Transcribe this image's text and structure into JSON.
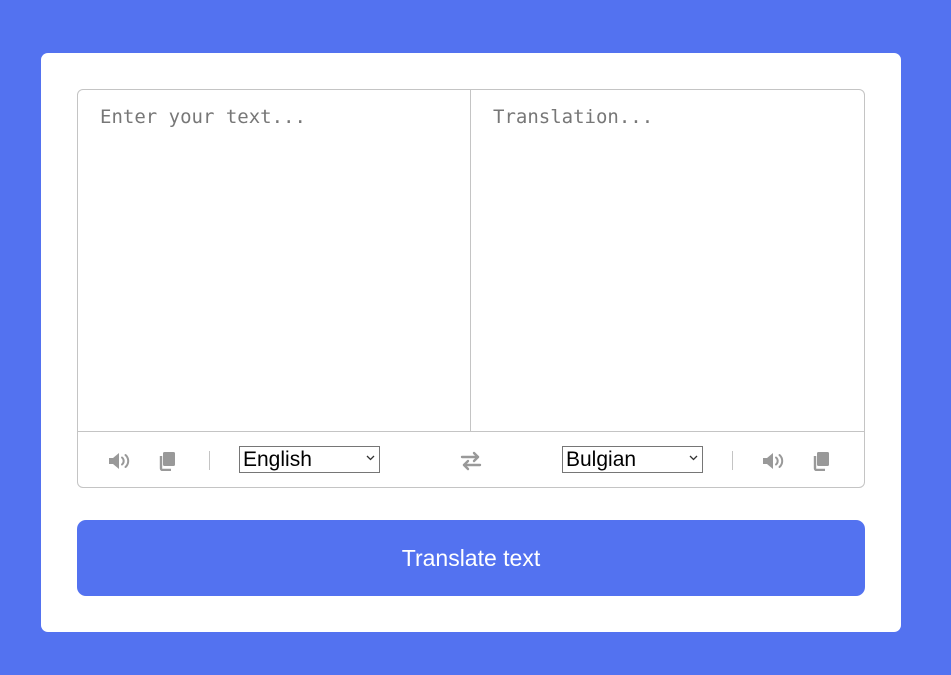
{
  "source": {
    "placeholder": "Enter your text...",
    "language": "English",
    "languages": [
      "English"
    ]
  },
  "target": {
    "placeholder": "Translation...",
    "language": "Bulgian",
    "languages": [
      "Bulgian"
    ]
  },
  "icons": {
    "speak": "volume-icon",
    "copy": "copy-icon",
    "swap": "exchange-icon"
  },
  "translate_button": {
    "label": "Translate text"
  },
  "colors": {
    "background": "#5372F0",
    "card": "#FFFFFF",
    "icon": "#999999",
    "border": "#C4C4C4"
  }
}
